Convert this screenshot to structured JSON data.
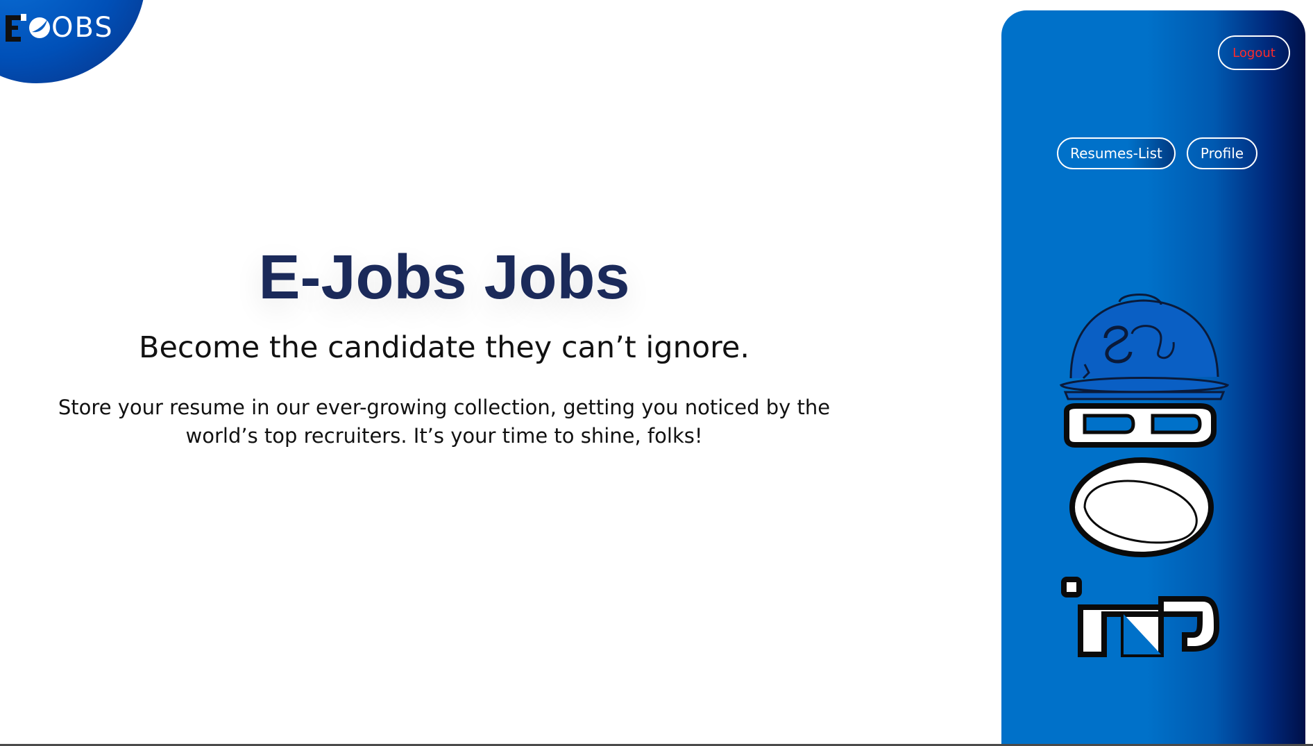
{
  "header": {
    "logo_text": "OBS",
    "logo_full": "EJOBS"
  },
  "hero": {
    "title": "E-Jobs Jobs",
    "subtitle": "Become the candidate they can’t ignore.",
    "description": "Store your resume in our ever-growing collection, getting you noticed by the world’s top recruiters. It’s your time to shine, folks!"
  },
  "side_panel": {
    "logout_label": "Logout",
    "nav": [
      {
        "label": "Resumes-List"
      },
      {
        "label": "Profile"
      }
    ],
    "illustration_icon": "hard-hat-job-icon"
  },
  "colors": {
    "title": "#1b2a5a",
    "panel_blue": "#0071c9",
    "panel_dark": "#001048",
    "logout_text": "#ff2a2a"
  }
}
